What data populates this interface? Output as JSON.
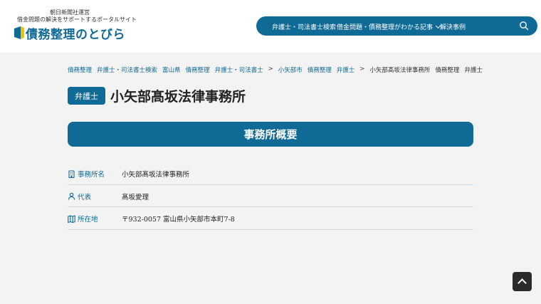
{
  "header": {
    "sub1": "朝日新聞社運営",
    "sub2": "借金問題の解決をサポートするポータルサイト",
    "logo_text": "債務整理のとびら",
    "nav": [
      {
        "label": "弁護士・司法書士検索"
      },
      {
        "label": "借金問題・債務整理がわかる記事"
      },
      {
        "label": "解決事例"
      }
    ],
    "search_icon": "search-icon"
  },
  "breadcrumb": [
    {
      "label": "債務整理",
      "type": "link"
    },
    {
      "label": "弁護士・司法書士検索",
      "type": "link"
    },
    {
      "label": "富山県",
      "type": "link"
    },
    {
      "label": "債務整理",
      "type": "link"
    },
    {
      "label": "弁護士・司法書士",
      "type": "link"
    },
    {
      "label": ">",
      "type": "sep"
    },
    {
      "label": "小矢部市",
      "type": "link"
    },
    {
      "label": "債務整理",
      "type": "link"
    },
    {
      "label": "弁護士",
      "type": "link"
    },
    {
      "label": ">",
      "type": "sep"
    },
    {
      "label": "小矢部髙坂法律事務所",
      "type": "text"
    },
    {
      "label": "債務整理",
      "type": "text"
    },
    {
      "label": "弁護士",
      "type": "text"
    }
  ],
  "page": {
    "badge": "弁護士",
    "title": "小矢部髙坂法律事務所",
    "section_title": "事務所概要"
  },
  "info": [
    {
      "icon": "building-icon",
      "label": "事務所名",
      "value": "小矢部髙坂法律事務所"
    },
    {
      "icon": "person-icon",
      "label": "代表",
      "value": "髙坂愛理"
    },
    {
      "icon": "map-icon",
      "label": "所在地",
      "value": "〒932-0057 富山県小矢部市本町7-8"
    }
  ],
  "colors": {
    "brand": "#0f6a96",
    "background": "#f3f3f3",
    "scroll_button": "#2b2b2b"
  }
}
